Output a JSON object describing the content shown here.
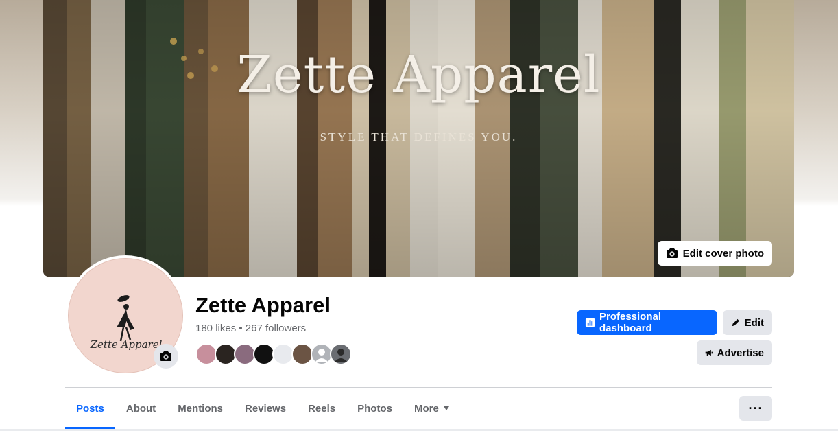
{
  "cover": {
    "title": "Zette Apparel",
    "tagline": "STYLE THAT DEFINES YOU.",
    "edit_label": "Edit cover photo",
    "icon": "camera-icon"
  },
  "profile": {
    "avatar_text": "Zette Apparel",
    "name": "Zette Apparel",
    "stats": "180 likes • 267 followers",
    "camera_icon": "camera-icon",
    "follower_avatar_count": 8
  },
  "actions": {
    "dashboard_label": "Professional dashboard",
    "dashboard_icon": "chart-icon",
    "edit_label": "Edit",
    "edit_icon": "pencil-icon",
    "advertise_label": "Advertise",
    "advertise_icon": "megaphone-icon"
  },
  "tabs": {
    "items": [
      {
        "label": "Posts",
        "active": true
      },
      {
        "label": "About"
      },
      {
        "label": "Mentions"
      },
      {
        "label": "Reviews"
      },
      {
        "label": "Reels"
      },
      {
        "label": "Photos"
      },
      {
        "label": "More"
      }
    ],
    "more_icon": "caret-down-icon",
    "overflow_label": "···"
  },
  "colors": {
    "accent": "#0866ff",
    "secondary_bg": "#e4e6eb",
    "muted_text": "#65676b",
    "avatar_bg": "#f2d6ce"
  }
}
